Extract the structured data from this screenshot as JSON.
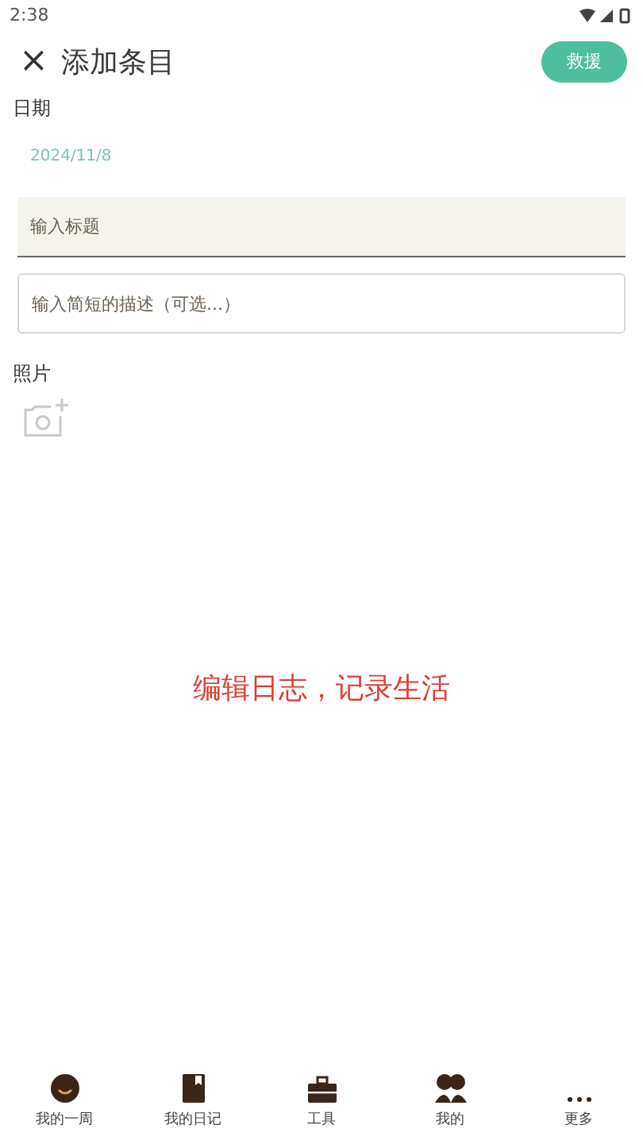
{
  "status_bar": {
    "time": "2:38"
  },
  "header": {
    "close": "×",
    "title": "添加条目",
    "action_button": "救援"
  },
  "date_section": {
    "label": "日期",
    "value": "2024/11/8"
  },
  "title_field": {
    "placeholder": "输入标题"
  },
  "description_field": {
    "placeholder": "输入简短的描述（可选...）"
  },
  "photos_section": {
    "label": "照片"
  },
  "caption": "编辑日志，记录生活",
  "bottom_nav": [
    {
      "label": "我的一周"
    },
    {
      "label": "我的日记"
    },
    {
      "label": "工具"
    },
    {
      "label": "我的"
    },
    {
      "label": "更多"
    }
  ]
}
